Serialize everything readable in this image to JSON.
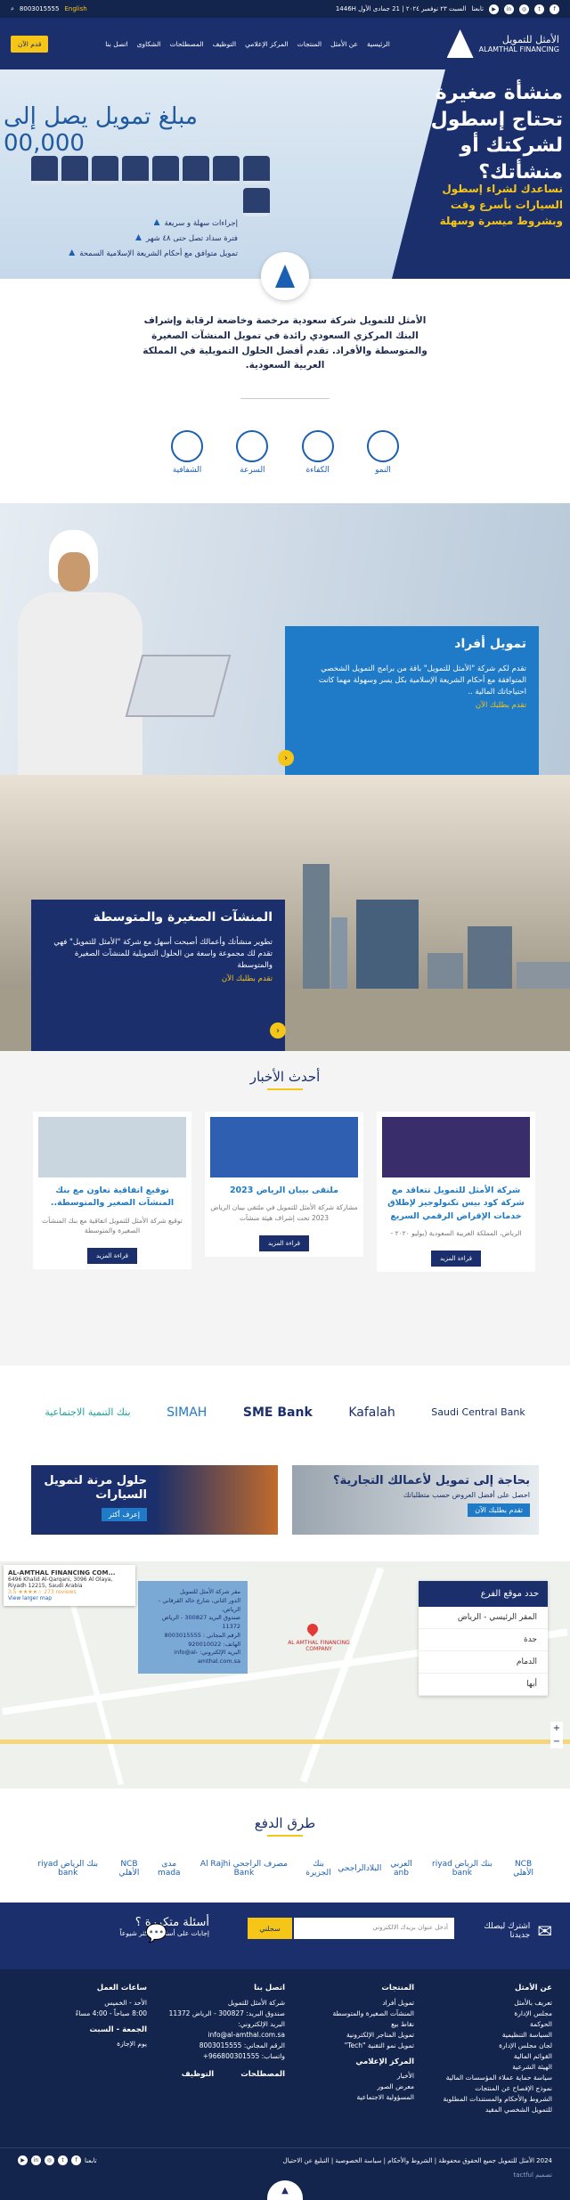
{
  "topbar": {
    "phone": "8003015555",
    "lang": "English",
    "follow": "تابعنا",
    "date": "السبت ٢٣ نوفمبر ٢٠٢٤ | 21 جمادى الأول 1446H",
    "social": [
      "facebook-icon",
      "twitter-icon",
      "instagram-icon",
      "linkedin-icon",
      "youtube-icon"
    ]
  },
  "nav": {
    "logo_ar": "الأمثل للتمويل",
    "logo_en": "ALAMTHAL FINANCING",
    "items": [
      "الرئيسية",
      "عن الأمثل",
      "المنتجات",
      "المركز الإعلامي",
      "التوظيف",
      "المصطلحات",
      "الشكاوى",
      "اتصل بنا"
    ],
    "cta": "قدم الآن"
  },
  "hero": {
    "title": "منشأة صغيرة تحتاج إسطول لشركتك أو منشأتك؟",
    "subtitle": "نساعدك لشراء إسطول السيارات بأسرع وقت وبشروط ميسرة وسهلة",
    "amount": "مبلغ تمويل يصل إلى 00,000",
    "bullets": [
      "إجراءات سهلة و سريعة",
      "فترة سداد تصل حتى ٤٨ شهر",
      "تمويل متوافق مع أحكام الشريعة الإسلامية السمحة"
    ]
  },
  "about": {
    "text": "الأمثل للتمويل شركة سعودية مرخصة وخاضعة لرقابة وإشراف البنك المركزي السعودي رائدة في تمويل المنشآت الصغيرة والمتوسطة والأفراد. تقدم أفضل الحلول التمويلية في المملكة العربية السعودية.",
    "features": [
      "الشفافية",
      "السرعة",
      "الكفاءة",
      "النمو"
    ]
  },
  "individuals": {
    "title": "تمويل أفراد",
    "body": "تقدم لكم شركة \"الأمثل للتمويل\" باقة من برامج التمويل الشخصي المتوافقة مع أحكام الشريعة الإسلامية بكل يسر وسهولة مهما كانت احتياجاتك المالية ..",
    "link": "تقدم بطلبك الآن"
  },
  "sme": {
    "title": "المنشآت الصغيرة والمتوسطة",
    "body": "تطوير منشأتك وأعمالك أصبحت أسهل مع شركة \"الأمثل للتمويل\" فهي تقدم لك مجموعة واسعة من الحلول التمويلية للمنشآت الصغيرة والمتوسطة",
    "link": "تقدم بطلبك الآن"
  },
  "news": {
    "title": "أحدث الأخبار",
    "cards": [
      {
        "title": "شركة الأمثل للتمويل تتعاقد مع شركة كود بيس تكنولوجيز لإطلاق خدمات الإقراض الرقمي السريع",
        "body": "الرياض، المملكة العربية السعودية (يوليو ٢٠٢٠ -",
        "btn": "قراءة المزيد"
      },
      {
        "title": "ملتقى بيبان الرياض 2023",
        "body": "مشاركة شركة الأمثل للتمويل في ملتقى بيبان الرياض 2023 تحت إشراف هيئة منشآت",
        "btn": "قراءة المزيد"
      },
      {
        "title": "توقيع اتفاقية تعاون مع بنك المنشآت الصغير والمتوسطة..",
        "body": "توقيع شركة الأمثل للتمويل اتفاقية مع بنك المنشآت الصغيرة والمتوسطة",
        "btn": "قراءة المزيد"
      }
    ]
  },
  "partners": [
    "Saudi Central Bank",
    "Kafalah",
    "SME Bank",
    "SIMAH",
    "بنك التنمية الاجتماعية"
  ],
  "ads": {
    "business": {
      "title": "بحاجة إلى تمويل لأعمالك التجارية؟",
      "sub": "احصل على أفضل العروض حسب متطلباتك",
      "btn": "تقدم بطلبك الآن"
    },
    "cars": {
      "title": "حلول مرنة لتمويل السيارات",
      "btn": "إعرف أكثر"
    }
  },
  "map": {
    "branch_title": "حدد موقع الفرع",
    "branches": [
      "المقر الرئيسي - الرياض",
      "جدة",
      "الدمام",
      "أبها"
    ],
    "info": [
      "مقر شركة الأمثل للتمويل",
      "الدور الثاني، شارع خالد القرقاني - الرياض،",
      "صندوق البريد 300827 - الرياض 11372",
      "الرقم المجاني : 8003015555",
      "الهاتف: 920010022",
      "البريد الإلكتروني: info@al-amthal.com.sa"
    ],
    "gm_title": "AL-AMTHAL FINANCING COM...",
    "gm_addr": "6496 Khalid Al-Qarqani, 3096 Al Olaya, Riyadh 12215, Saudi Arabia",
    "gm_rating": "3.5 ★★★★☆ 273 reviews",
    "gm_link": "View larger map",
    "poi": "AL AMTHAL FINANCING COMPANY"
  },
  "payment": {
    "title": "طرق الدفع",
    "methods": [
      "NCB الأهلي",
      "بنك الرياض riyad bank",
      "العربي anb",
      "البلاد",
      "الراجحي",
      "بنك الجزيرة",
      "مصرف الراجحي Al Rajhi Bank",
      "مدى mada",
      "NCB الأهلي",
      "بنك الرياض riyad bank"
    ]
  },
  "subscribe": {
    "label": "اشترك ليصلك جديدنا",
    "placeholder": "أدخل عنوان بريدك الالكتروني",
    "btn": "سجلني",
    "faq_title": "أسئلة متكررة ؟",
    "faq_sub": "إجابات على أسئلتك الأكثر شيوعاً"
  },
  "footer": {
    "about": {
      "title": "عن الأمثل",
      "items": [
        "تعريف بالأمثل",
        "مجلس الإدارة",
        "الحوكمة",
        "السياسة التنظيمية",
        "لجان مجلس الإدارة",
        "القوائم المالية",
        "الهيئة الشرعية",
        "سياسة حماية عملاء المؤسسات المالية",
        "نموذج الإفصاح عن المنتجات",
        "الشروط والأحكام والمستندات المطلوبة للتمويل الشخصي المقيد"
      ]
    },
    "products": {
      "title": "المنتجات",
      "items": [
        "تمويل أفراد",
        "المنشآت الصغيرة والمتوسطة",
        "نقاط بيع",
        "تمويل المتاجر الإلكترونية",
        "تمويل نمو التقنية \"Tech\""
      ]
    },
    "media": {
      "title": "المركز الإعلامي",
      "items": [
        "الأخبار",
        "معرض الصور",
        "المسؤولية الاجتماعية"
      ]
    },
    "contact": {
      "title": "اتصل بنا",
      "items": [
        "شركة الأمثل للتمويل",
        "صندوق البريد: 300827 - الرياض 11372",
        "البريد الإلكتروني:",
        "info@al-amthal.com.sa",
        "الرقم المجاني: 8003015555",
        "واتساب: 966800301555+"
      ]
    },
    "terms": "المصطلحات",
    "jobs": "التوظيف",
    "hours": {
      "title": "ساعات العمل",
      "days": "الأحد - الخميس",
      "time": "8:00 صباحاً - 4:00 مساءً",
      "weekend_title": "الجمعة - السبت",
      "weekend": "يوم الإجازة"
    }
  },
  "bottom": {
    "copyright": "2024 الأمثل للتمويل جميع الحقوق محفوظة | الشروط والأحكام | سياسة الخصوصية | التبليغ عن الاحتيال",
    "design": "تصميم tactful",
    "follow": "تابعنا"
  }
}
